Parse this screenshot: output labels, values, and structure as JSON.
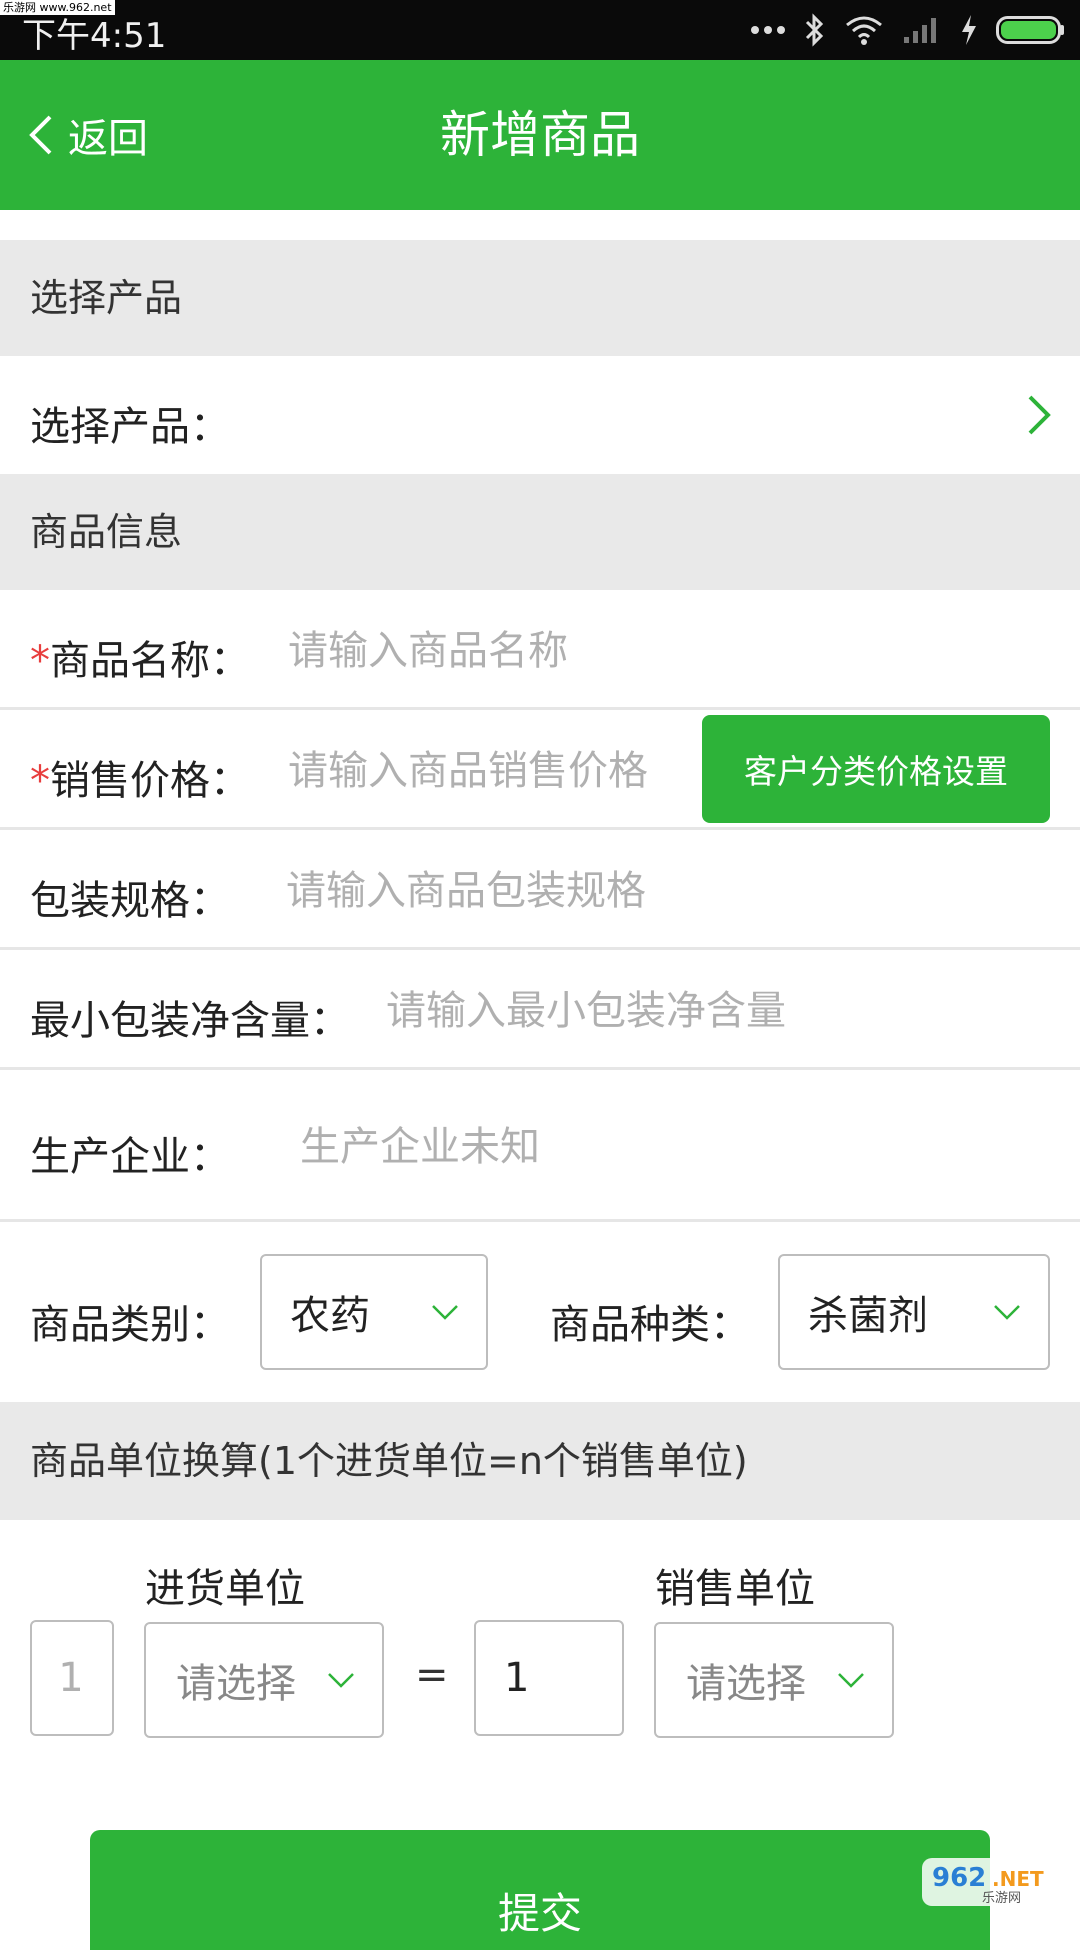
{
  "status": {
    "time": "下午4:51",
    "watermark": "乐游网 www.962.net"
  },
  "header": {
    "back_label": "返回",
    "title": "新增商品"
  },
  "sections": {
    "select_product": "选择产品",
    "product_info": "商品信息",
    "unit_conversion": "商品单位换算(1个进货单位=n个销售单位)"
  },
  "select_product_row": {
    "label": "选择产品："
  },
  "fields": {
    "name": {
      "required_mark": "*",
      "label": "商品名称：",
      "placeholder": "请输入商品名称",
      "value": ""
    },
    "price": {
      "required_mark": "*",
      "label": "销售价格：",
      "placeholder": "请输入商品销售价格",
      "value": "",
      "button_label": "客户分类价格设置"
    },
    "spec": {
      "label": "包装规格：",
      "placeholder": "请输入商品包装规格",
      "value": ""
    },
    "net_content": {
      "label": "最小包装净含量：",
      "placeholder": "请输入最小包装净含量",
      "value": ""
    },
    "manufacturer": {
      "label": "生产企业：",
      "placeholder": "生产企业未知",
      "value": ""
    }
  },
  "category": {
    "label": "商品类别：",
    "selected": "农药"
  },
  "kind": {
    "label": "商品种类：",
    "selected": "杀菌剂"
  },
  "units": {
    "purchase_label": "进货单位",
    "sales_label": "销售单位",
    "purchase_qty_placeholder": "1",
    "purchase_select": "请选择",
    "equals": "=",
    "sales_qty_value": "1",
    "sales_select": "请选择"
  },
  "submit_label": "提交",
  "corner_logo_text": "962.NET 乐游网",
  "colors": {
    "brand_green": "#2db339",
    "required_red": "#e83e3e",
    "section_bg": "#e9e9e9"
  }
}
